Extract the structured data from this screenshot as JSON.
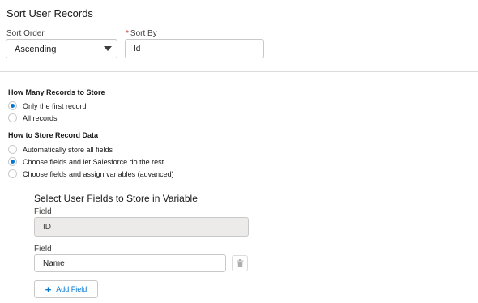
{
  "header": {
    "title": "Sort User Records"
  },
  "sort": {
    "order_label": "Sort Order",
    "order_value": "Ascending",
    "sortby_required": "*",
    "sortby_label": "Sort By",
    "sortby_value": "Id"
  },
  "records": {
    "title": "How Many Records to Store",
    "options": [
      {
        "label": "Only the first record",
        "checked": true
      },
      {
        "label": "All records",
        "checked": false
      }
    ]
  },
  "storage": {
    "title": "How to Store Record Data",
    "options": [
      {
        "label": "Automatically store all fields",
        "checked": false
      },
      {
        "label": "Choose fields and let Salesforce do the rest",
        "checked": true
      },
      {
        "label": "Choose fields and assign variables (advanced)",
        "checked": false
      }
    ]
  },
  "fields": {
    "title": "Select User Fields to Store in Variable",
    "items": [
      {
        "label": "Field",
        "value": "ID",
        "disabled": true
      },
      {
        "label": "Field",
        "value": "Name",
        "disabled": false
      }
    ],
    "add_label": "Add Field"
  },
  "icons": {
    "delete": "trash-icon",
    "add": "plus-icon",
    "dropdown": "chevron-down-icon"
  },
  "colors": {
    "accent": "#0176d3",
    "border": "#c9c9c9",
    "required": "#c23934"
  }
}
